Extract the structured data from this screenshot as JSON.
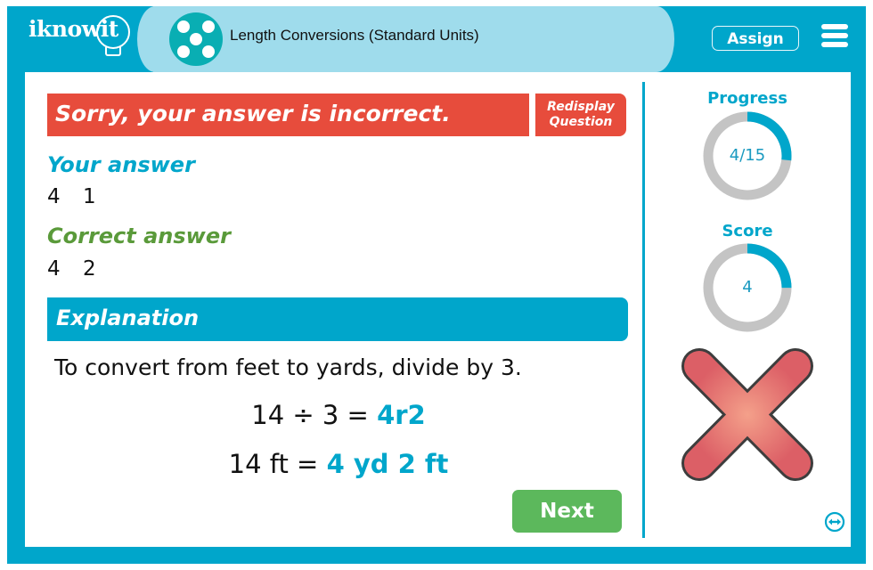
{
  "header": {
    "logo": "iknowit",
    "app_title": "Length Conversions (Standard Units)",
    "assign_label": "Assign",
    "menu_icon": "hamburger-menu-icon",
    "badge_icon": "dice-five-icon"
  },
  "feedback": {
    "banner": "Sorry, your answer is incorrect.",
    "redisplay_line1": "Redisplay",
    "redisplay_line2": "Question",
    "your_answer_label": "Your answer",
    "your_answer_value": "4 1",
    "correct_answer_label": "Correct answer",
    "correct_answer_value": "4 2"
  },
  "explanation": {
    "title": "Explanation",
    "text": "To convert from feet to yards, divide by 3.",
    "eq1_left": "14 ÷ 3 = ",
    "eq1_right": "4r2",
    "eq2_left": "14 ft = ",
    "eq2_right": "4 yd 2 ft"
  },
  "next_label": "Next",
  "sidebar": {
    "progress_label": "Progress",
    "progress_value": "4/15",
    "progress_fraction": 0.2667,
    "score_label": "Score",
    "score_value": "4",
    "score_fraction": 0.25,
    "result_icon": "red-x-icon",
    "swap_icon": "swap-arrows-icon"
  },
  "colors": {
    "brand": "#00a6cb",
    "error": "#e74c3c",
    "correct": "#5a9a3a",
    "next": "#5cb85c",
    "ring_track": "#c4c4c4"
  }
}
